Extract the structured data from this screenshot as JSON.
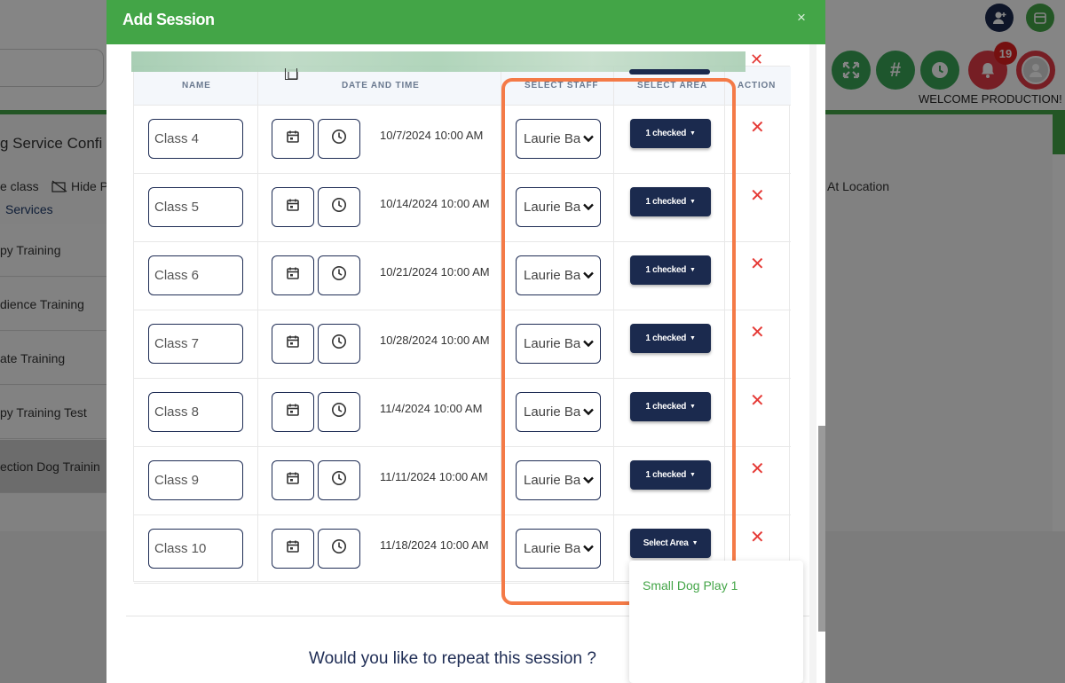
{
  "background": {
    "page_title": "g Service Confi",
    "toolbar_left": "e class",
    "toolbar_hide": "Hide P",
    "services_label": "Services",
    "at_location": "At Location",
    "sidebar_items": [
      "py Training",
      "dience Training",
      "ate Training",
      "py Training Test",
      "ection Dog Trainin"
    ],
    "notification_count": "19",
    "welcome_text": "WELCOME PRODUCTION!"
  },
  "modal": {
    "title": "Add Session",
    "close_label": "×",
    "columns": {
      "name": "NAME",
      "date_time": "DATE AND TIME",
      "staff": "SELECT STAFF",
      "area": "SELECT AREA",
      "action": "ACTION"
    },
    "rows": [
      {
        "name": "Class 4",
        "datetime": "10/7/2024 10:00 AM",
        "staff": "Laurie Ba",
        "area": "1 checked"
      },
      {
        "name": "Class 5",
        "datetime": "10/14/2024 10:00 AM",
        "staff": "Laurie Ba",
        "area": "1 checked"
      },
      {
        "name": "Class 6",
        "datetime": "10/21/2024 10:00 AM",
        "staff": "Laurie Ba",
        "area": "1 checked"
      },
      {
        "name": "Class 7",
        "datetime": "10/28/2024 10:00 AM",
        "staff": "Laurie Ba",
        "area": "1 checked"
      },
      {
        "name": "Class 8",
        "datetime": "11/4/2024 10:00 AM",
        "staff": "Laurie Ba",
        "area": "1 checked"
      },
      {
        "name": "Class 9",
        "datetime": "11/11/2024 10:00 AM",
        "staff": "Laurie Ba",
        "area": "1 checked"
      },
      {
        "name": "Class 10",
        "datetime": "11/18/2024 10:00 AM",
        "staff": "Laurie Ba",
        "area": "Select Area"
      }
    ],
    "delete_label": "✕",
    "area_dropdown": {
      "options": [
        "Small Dog Play 1"
      ]
    },
    "repeat_question": "Would you like to repeat this session ?"
  },
  "colors": {
    "primary_green": "#43a547",
    "navy": "#1b2a4e",
    "delete_red": "#e53935",
    "highlight_orange": "#f47a47"
  }
}
